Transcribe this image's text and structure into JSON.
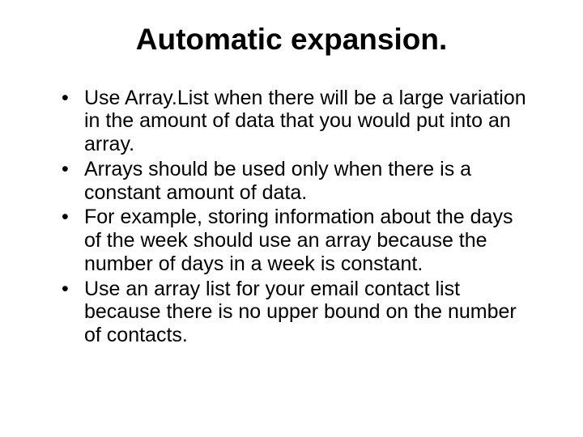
{
  "slide": {
    "title": "Automatic expansion.",
    "bullets": [
      "Use Array.List when there will be a large variation in the amount of data that you would put into an array.",
      "Arrays should be used only when there is a constant amount of data.",
      "For example, storing information about the days of the week should use an array because the number of days in a week is constant.",
      "Use an array list for your email contact list because there is no upper bound on the number of contacts."
    ]
  }
}
